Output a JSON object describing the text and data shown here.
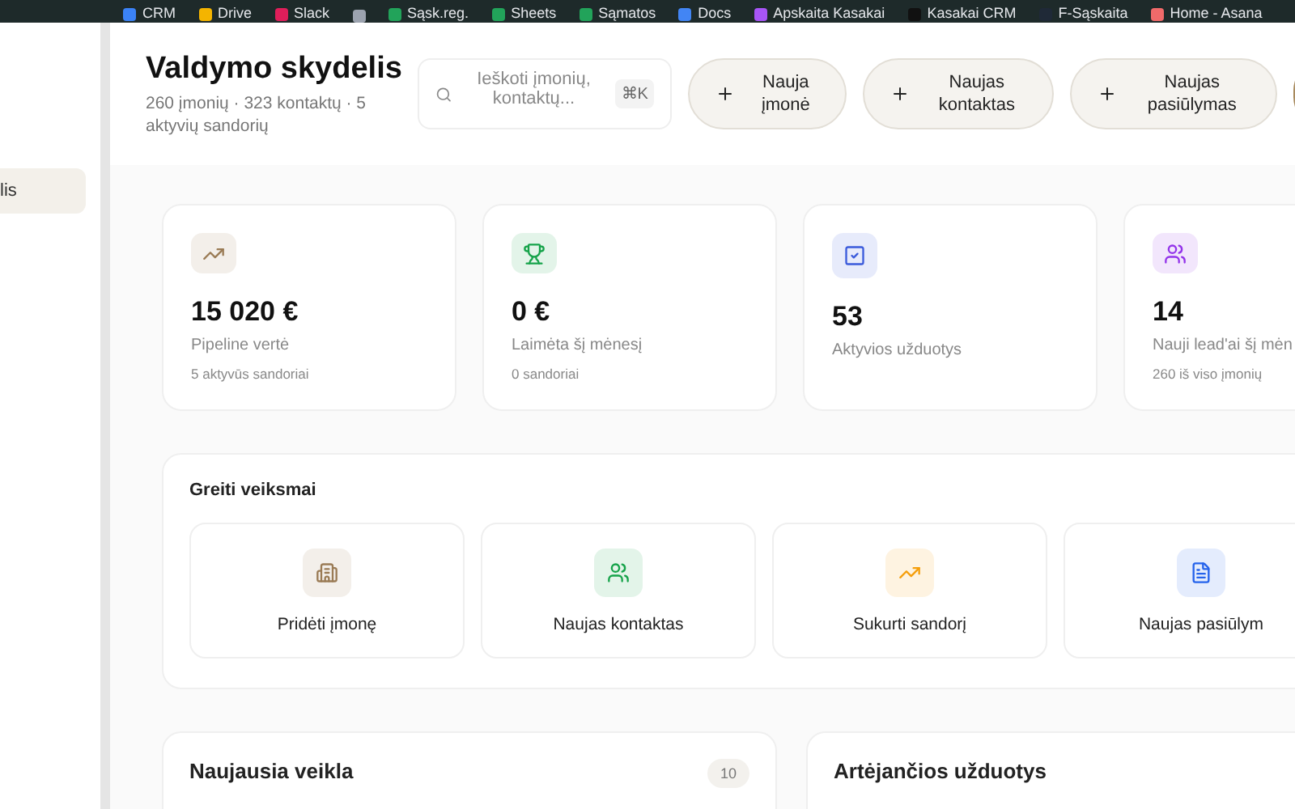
{
  "bookmarks": [
    {
      "label": "CRM",
      "color": "#3b82f6"
    },
    {
      "label": "Drive",
      "color": "#f4b400"
    },
    {
      "label": "Slack",
      "color": "#e01e5a"
    },
    {
      "color": "#9ca3af"
    },
    {
      "label": "Sąsk.reg.",
      "color": "#22a35a"
    },
    {
      "label": "Sheets",
      "color": "#22a35a"
    },
    {
      "label": "Sąmatos",
      "color": "#22a35a"
    },
    {
      "label": "Docs",
      "color": "#4285f4"
    },
    {
      "label": "Apskaita Kasakai",
      "color": "#a855f7"
    },
    {
      "label": "Kasakai CRM",
      "color": "#111111"
    },
    {
      "label": "F-Sąskaita",
      "color": "#1f2937"
    },
    {
      "label": "Home - Asana",
      "color": "#f06a6a"
    }
  ],
  "sidebar": {
    "items": [
      {
        "label": "lis",
        "selected": true
      }
    ]
  },
  "header": {
    "title": "Valdymo skydelis",
    "subtitle": "260 įmonių · 323 kontaktų · 5 aktyvių sandorių",
    "search": {
      "placeholder": "Ieškoti įmonių, kontaktų...",
      "shortcut": "⌘K"
    },
    "buttons": [
      "Nauja įmonė",
      "Naujas kontaktas",
      "Naujas pasiūlymas"
    ]
  },
  "stats": [
    {
      "kind": "trend",
      "color": "#9a7b55",
      "value": "15 020 €",
      "label": "Pipeline vertė",
      "note": "5 aktyvūs sandoriai"
    },
    {
      "kind": "trophy",
      "color": "#16a34a",
      "value": "0 €",
      "label": "Laimėta šį mėnesį",
      "note": "0 sandoriai"
    },
    {
      "kind": "check",
      "color": "#3b5bdb",
      "value": "53",
      "label": "Aktyvios užduotys"
    },
    {
      "kind": "users",
      "color": "#9333ea",
      "value": "14",
      "label": "Nauji lead'ai šį mėn",
      "note": "260 iš viso įmonių"
    }
  ],
  "quick_actions": {
    "title": "Greiti veiksmai",
    "items": [
      {
        "kind": "building",
        "color": "#9a7b55",
        "label": "Pridėti įmonę"
      },
      {
        "kind": "users",
        "color": "#16a34a",
        "label": "Naujas kontaktas"
      },
      {
        "kind": "trend",
        "color": "#f59e0b",
        "label": "Sukurti sandorį"
      },
      {
        "kind": "file",
        "color": "#2563eb",
        "label": "Naujas pasiūlym"
      }
    ]
  },
  "panels": [
    {
      "title": "Naujausia veikla",
      "count": "10"
    },
    {
      "title": "Artėjančios užduotys"
    }
  ]
}
